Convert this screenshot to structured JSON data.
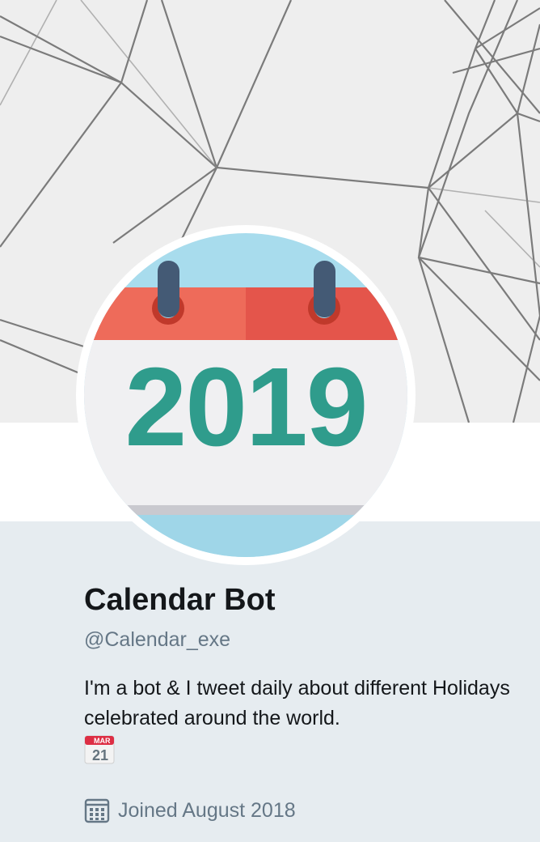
{
  "profile": {
    "name": "Calendar Bot",
    "handle": "@Calendar_exe",
    "bio": "I'm a bot & I tweet daily about different Holidays celebrated around the world.",
    "bio_emoji": {
      "icon": "calendar-emoji-icon",
      "month": "MAR",
      "day": "21"
    },
    "joined": "Joined August 2018"
  },
  "avatar": {
    "year": "2019"
  },
  "colors": {
    "text_primary": "#14171a",
    "text_secondary": "#657786",
    "background": "#e6ecf0",
    "teal": "#2f9c8c",
    "calendar_red": "#e4554b",
    "sky": "#a8dced"
  }
}
